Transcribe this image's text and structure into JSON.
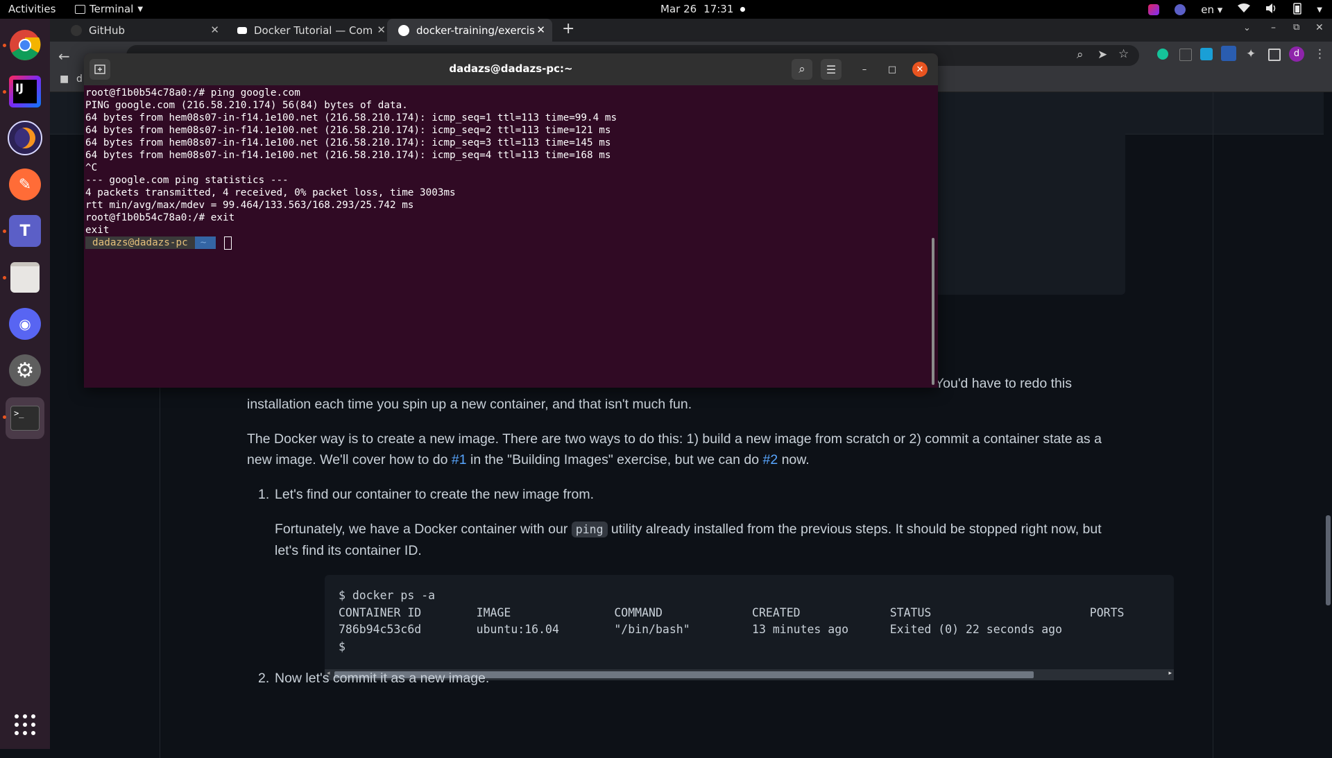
{
  "topbar": {
    "activities": "Activities",
    "app_name": "Terminal",
    "date": "Mar 26",
    "time": "17:31",
    "lang": "en"
  },
  "browser": {
    "tabs": [
      {
        "label": "GitHub"
      },
      {
        "label": "Docker Tutorial — Compl"
      },
      {
        "label": "docker-training/exercises"
      }
    ],
    "new_tab": "+",
    "bookmark_partial": "d"
  },
  "terminal": {
    "title": "dadazs@dadazs-pc:~",
    "lines": [
      "root@f1b0b54c78a0:/# ping google.com",
      "PING google.com (216.58.210.174) 56(84) bytes of data.",
      "64 bytes from hem08s07-in-f14.1e100.net (216.58.210.174): icmp_seq=1 ttl=113 time=99.4 ms",
      "64 bytes from hem08s07-in-f14.1e100.net (216.58.210.174): icmp_seq=2 ttl=113 time=121 ms",
      "64 bytes from hem08s07-in-f14.1e100.net (216.58.210.174): icmp_seq=3 ttl=113 time=145 ms",
      "64 bytes from hem08s07-in-f14.1e100.net (216.58.210.174): icmp_seq=4 ttl=113 time=168 ms",
      "^C",
      "--- google.com ping statistics ---",
      "4 packets transmitted, 4 received, 0% packet loss, time 3003ms",
      "rtt min/avg/max/mdev = 99.464/133.563/168.293/25.742 ms",
      "root@f1b0b54c78a0:/# exit",
      "exit"
    ],
    "prompt_user": "dadazs@dadazs-pc",
    "prompt_dir": "~"
  },
  "page": {
    "p1_end": "? You'd have to redo this",
    "p1_line2": "installation each time you spin up a new container, and that isn't much fun.",
    "p2_a": "The Docker way is to create a new image. There are two ways to do this: 1) build a new image from scratch or 2) commit a container state as a",
    "p2_b": "new image. We'll cover how to do ",
    "p2_link1": "#1",
    "p2_c": " in the \"Building Images\" exercise, but we can do ",
    "p2_link2": "#2",
    "p2_d": " now.",
    "step1_num": "1.",
    "step1": "Let's find our container to create the new image from.",
    "step1_p_a": "Fortunately, we have a Docker container with our ",
    "step1_code": "ping",
    "step1_p_b": " utility already installed from the previous steps. It should be stopped right now, but",
    "step1_p_c": "let's find its container ID.",
    "code_lines": [
      "$ docker ps -a",
      "CONTAINER ID        IMAGE               COMMAND             CREATED             STATUS                       PORTS",
      "786b94c53c6d        ubuntu:16.04        \"/bin/bash\"         13 minutes ago      Exited (0) 22 seconds ago",
      "$"
    ],
    "step2_num": "2.",
    "step2": "Now let's commit it as a new image."
  }
}
